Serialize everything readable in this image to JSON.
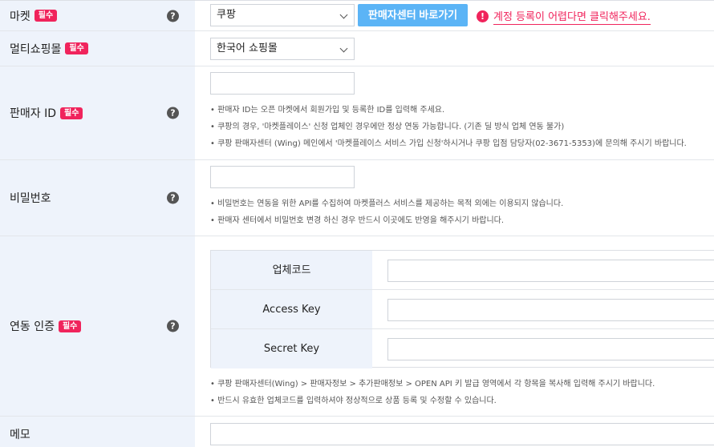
{
  "market": {
    "label": "마켓",
    "badge": "필수",
    "select_value": "쿠팡",
    "seller_center_button": "판매자센터 바로가기",
    "alert_icon": "!",
    "alert_text": "계정 등록이 어렵다면 클릭해주세요."
  },
  "multishop": {
    "label": "멀티쇼핑몰",
    "badge": "필수",
    "select_value": "한국어 쇼핑몰"
  },
  "seller_id": {
    "label": "판매자 ID",
    "badge": "필수",
    "input_value": "",
    "notes": [
      "• 판매자 ID는 오픈 마켓에서 회원가입 및 등록한 ID를 입력해 주세요.",
      "• 쿠팡의 경우, '마켓플레이스' 신청 업체인 경우에만 정상 연동 가능합니다. (기존 딜 방식 업체 연동 불가)",
      "• 쿠팡 판매자센터 (Wing) 메인에서 '마켓플레이스 서비스 가입 신청'하시거나 쿠팡 입점 담당자(02-3671-5353)에 문의해 주시기 바랍니다."
    ]
  },
  "password": {
    "label": "비밀번호",
    "input_value": "",
    "notes": [
      "• 비밀번호는 연동을 위한 API를 수집하여 마켓플러스 서비스를 제공하는 목적 외에는 이용되지 않습니다.",
      "• 판매자 센터에서 비밀번호 변경 하신 경우 반드시 이곳에도 반영을 해주시기 바랍니다."
    ]
  },
  "auth": {
    "label": "연동 인증",
    "badge": "필수",
    "fields": [
      {
        "label": "업체코드",
        "value": ""
      },
      {
        "label": "Access Key",
        "value": ""
      },
      {
        "label": "Secret Key",
        "value": ""
      }
    ],
    "notes": [
      "• 쿠팡 판매자센터(Wing) > 판매자정보 > 추가판매정보 > OPEN API 키 발급 영역에서 각 항목을 복사해 입력해 주시기 바랍니다.",
      "• 반드시 유효한 업체코드를 입력하셔야 정상적으로 상품 등록 및 수정할 수 있습니다."
    ]
  },
  "memo": {
    "label": "메모",
    "input_value": ""
  },
  "help_icon_glyph": "?",
  "colors": {
    "badge": "#f0245c",
    "button": "#5bb4f6",
    "label_bg": "#eef3fb"
  }
}
